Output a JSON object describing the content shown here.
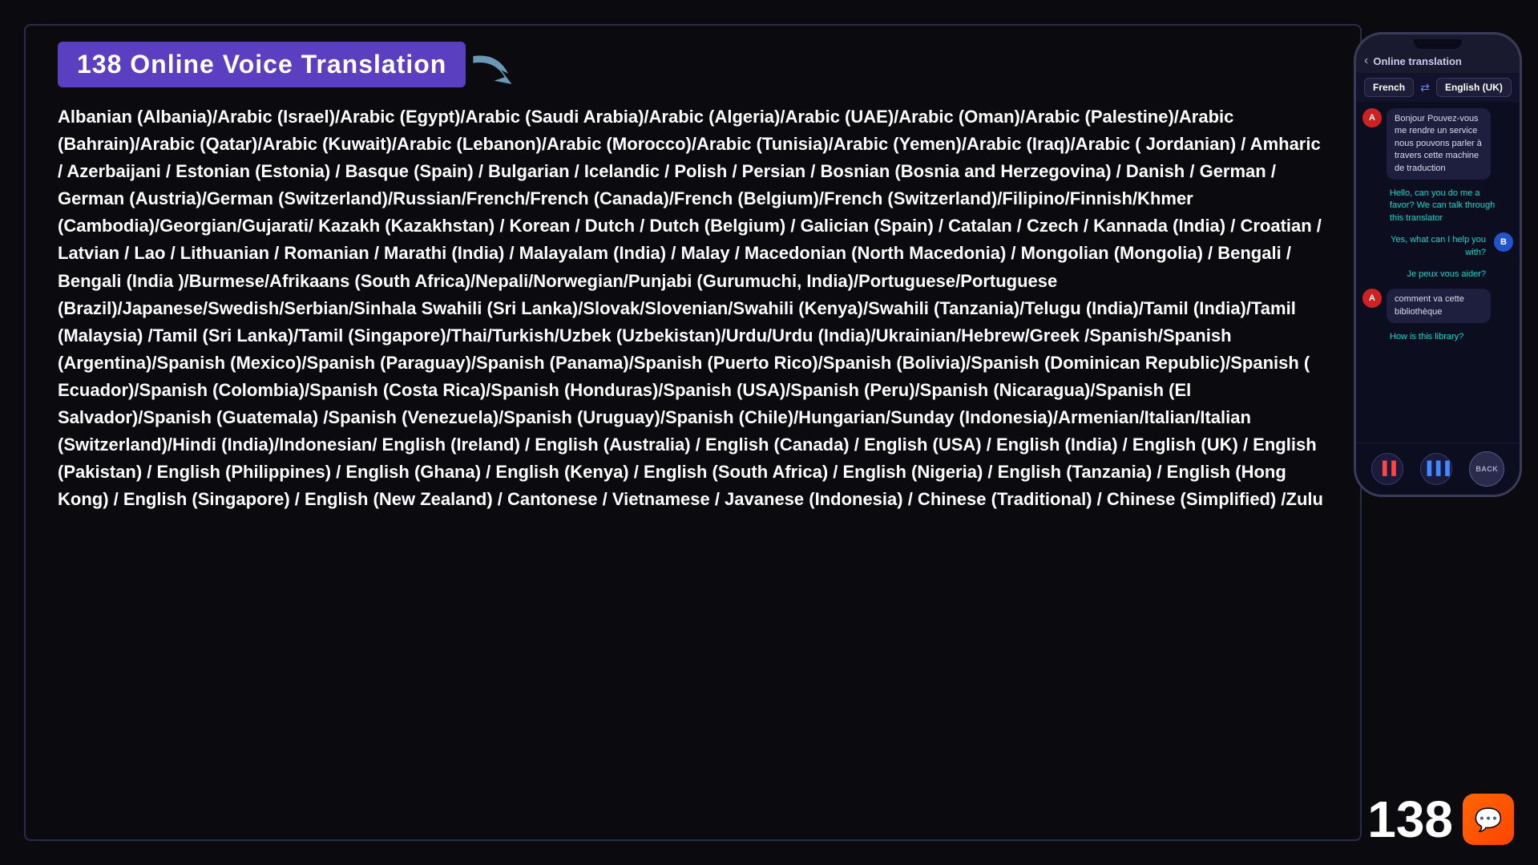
{
  "title": "138 Online Voice Translation",
  "languages_text": "Albanian (Albania)/Arabic (Israel)/Arabic (Egypt)/Arabic (Saudi Arabia)/Arabic (Algeria)/Arabic (UAE)/Arabic (Oman)/Arabic (Palestine)/Arabic (Bahrain)/Arabic (Qatar)/Arabic (Kuwait)/Arabic (Lebanon)/Arabic (Morocco)/Arabic (Tunisia)/Arabic (Yemen)/Arabic (Iraq)/Arabic ( Jordanian) / Amharic / Azerbaijani / Estonian (Estonia) / Basque (Spain) / Bulgarian / Icelandic / Polish / Persian / Bosnian (Bosnia and Herzegovina) / Danish / German / German (Austria)/German (Switzerland)/Russian/French/French (Canada)/French (Belgium)/French (Switzerland)/Filipino/Finnish/Khmer (Cambodia)/Georgian/Gujarati/ Kazakh (Kazakhstan) / Korean / Dutch / Dutch (Belgium) / Galician (Spain) / Catalan / Czech / Kannada (India) / Croatian / Latvian / Lao / Lithuanian / Romanian / Marathi (India) / Malayalam (India) / Malay / Macedonian (North Macedonia) / Mongolian (Mongolia) / Bengali / Bengali (India )/Burmese/Afrikaans (South Africa)/Nepali/Norwegian/Punjabi (Gurumuchi, India)/Portuguese/Portuguese (Brazil)/Japanese/Swedish/Serbian/Sinhala Swahili (Sri Lanka)/Slovak/Slovenian/Swahili (Kenya)/Swahili (Tanzania)/Telugu (India)/Tamil (India)/Tamil (Malaysia) /Tamil (Sri Lanka)/Tamil (Singapore)/Thai/Turkish/Uzbek (Uzbekistan)/Urdu/Urdu (India)/Ukrainian/Hebrew/Greek /Spanish/Spanish (Argentina)/Spanish (Mexico)/Spanish (Paraguay)/Spanish (Panama)/Spanish (Puerto Rico)/Spanish (Bolivia)/Spanish (Dominican Republic)/Spanish ( Ecuador)/Spanish (Colombia)/Spanish (Costa Rica)/Spanish (Honduras)/Spanish (USA)/Spanish (Peru)/Spanish (Nicaragua)/Spanish (El Salvador)/Spanish (Guatemala) /Spanish (Venezuela)/Spanish (Uruguay)/Spanish (Chile)/Hungarian/Sunday (Indonesia)/Armenian/Italian/Italian (Switzerland)/Hindi (India)/Indonesian/ English (Ireland) / English (Australia) / English (Canada) / English (USA) / English (India) / English (UK) / English (Pakistan) / English (Philippines) / English (Ghana) / English (Kenya) / English (South Africa) / English (Nigeria) / English (Tanzania) / English (Hong Kong) / English (Singapore) / English (New Zealand) / Cantonese / Vietnamese / Javanese (Indonesia) / Chinese (Traditional) / Chinese (Simplified) /Zulu",
  "phone": {
    "header_title": "Online translation",
    "lang_from": "French",
    "lang_to": "English (UK)",
    "messages": [
      {
        "side": "left",
        "avatar": "A",
        "bubble_text": "Bonjour Pouvez-vous me rendre un service nous pouvons parler à travers cette machine de traduction",
        "translation": "Hello, can you do me a favor? We can talk through this translator"
      },
      {
        "side": "right",
        "avatar": "B",
        "bubble_text": "Yes, what can I help you with?",
        "translation": "Je peux vous aider?"
      },
      {
        "side": "left",
        "avatar": "A",
        "bubble_text": "comment va cette bibliothèque",
        "translation": "How is this library?"
      }
    ]
  },
  "badge_number": "138",
  "controls": {
    "mic_icon": "🎤",
    "wave_icon": "📊",
    "back_label": "BACK"
  }
}
